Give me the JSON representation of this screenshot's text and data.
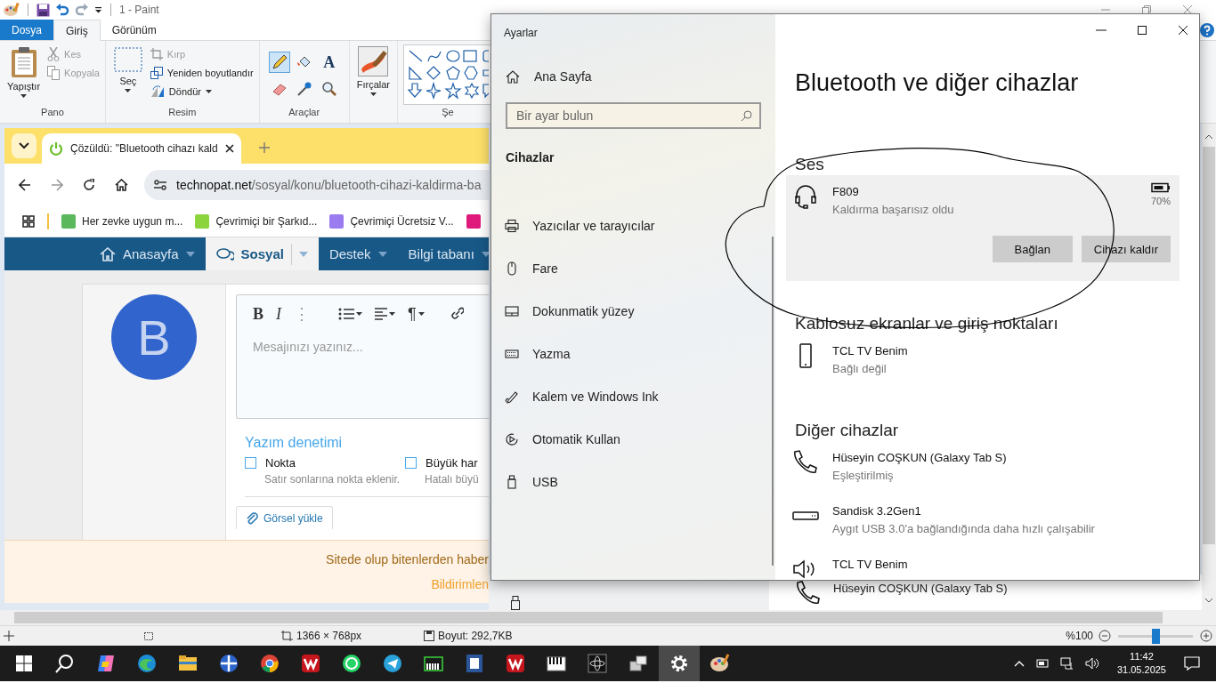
{
  "paint": {
    "title": "1 - Paint",
    "tabs": [
      {
        "label": "Dosya",
        "kind": "file",
        "selected": false
      },
      {
        "label": "Giriş",
        "kind": "tab",
        "selected": true
      },
      {
        "label": "Görünüm",
        "kind": "tab",
        "selected": false
      }
    ],
    "groups": [
      {
        "kind": "big",
        "label": "Pano",
        "big": {
          "kind": "clipboard",
          "label": "Yapıştır"
        },
        "items": [
          {
            "kind": "scissors",
            "label": "Kes",
            "disabled": true
          },
          {
            "kind": "copy",
            "label": "Kopyala",
            "disabled": true
          }
        ]
      },
      {
        "kind": "big",
        "label": "Resim",
        "big": {
          "kind": "select",
          "label": "Seç"
        },
        "items": [
          {
            "kind": "crop",
            "label": "Kırp",
            "disabled": true
          },
          {
            "kind": "resize",
            "label": "Yeniden boyutlandır",
            "disabled": false
          },
          {
            "kind": "rotate",
            "label": "Döndür",
            "disabled": false,
            "dropdown": true
          }
        ]
      },
      {
        "kind": "tools",
        "label": "Araçlar",
        "tools": [
          {
            "kind": "pencil",
            "selected": true
          },
          {
            "kind": "fill",
            "selected": false
          },
          {
            "kind": "text",
            "label": "A",
            "selected": false
          },
          {
            "kind": "eraser",
            "selected": false
          },
          {
            "kind": "picker",
            "selected": false
          },
          {
            "kind": "magnifier",
            "selected": false
          }
        ]
      },
      {
        "kind": "big",
        "big": {
          "kind": "brush",
          "label": "Fırçalar"
        }
      },
      {
        "kind": "shapes",
        "label": "Şe"
      }
    ],
    "status": {
      "size": "1366 × 768px",
      "file_size": "Boyut: 292,7KB",
      "zoom": "%100",
      "zoom_slider": {
        "level": 0.5
      }
    }
  },
  "browser": {
    "tab_title": "Çözüldü: \"Bluetooth cihazı kald",
    "domain": "technopat.net",
    "path": "/sosyal/konu/bluetooth-cihazi-kaldirma-ba",
    "bookmarks": [
      {
        "label": "Her zevke uygun m...",
        "color": "#5cb85c"
      },
      {
        "label": "Çevrimiçi bir Şarkıd...",
        "color": "#8cd43c"
      },
      {
        "label": "Çevrimiçi Ücretsiz V...",
        "color": "#9a7cf0"
      },
      {
        "color": "#e0197d"
      }
    ],
    "nav": [
      {
        "label": "Anasayfa",
        "kind": "home",
        "selected": false
      },
      {
        "label": "Sosyal",
        "kind": "chat",
        "selected": true
      },
      {
        "label": "Destek",
        "kind": "plain",
        "selected": false
      },
      {
        "label": "Bilgi tabanı",
        "kind": "plain",
        "selected": false
      }
    ],
    "avatar": "B",
    "toolbar": [
      {
        "kind": "bold",
        "label": "B"
      },
      {
        "kind": "italic",
        "label": "I"
      },
      {
        "kind": "more",
        "label": "⋮"
      },
      {
        "kind": "list"
      },
      {
        "kind": "align"
      },
      {
        "kind": "paragraph",
        "label": "¶"
      },
      {
        "kind": "link"
      }
    ],
    "placeholder": "Mesajınızı yazınız...",
    "spellcheck_title": "Yazım denetimi",
    "options": [
      {
        "label": "Nokta",
        "hint": "Satır sonlarına nokta eklenir.",
        "checked": false
      },
      {
        "label": "Büyük har",
        "hint": "Hatalı büyü",
        "checked": false
      }
    ],
    "upload": "Görsel yükle",
    "notice": {
      "text": "Sitede olup bitenlerden haber",
      "link": "Bildirimlen"
    }
  },
  "background_device": "Hüseyin COŞKUN (Galaxy Tab S)",
  "settings": {
    "title": "Ayarlar",
    "home": "Ana Sayfa",
    "search_placeholder": "Bir ayar bulun",
    "section": "Cihazlar",
    "nav": [
      {
        "kind": "printer",
        "label": "Yazıcılar ve tarayıcılar"
      },
      {
        "kind": "mouse",
        "label": "Fare"
      },
      {
        "kind": "touchpad",
        "label": "Dokunmatik yüzey"
      },
      {
        "kind": "keyboard",
        "label": "Yazma"
      },
      {
        "kind": "pen",
        "label": "Kalem ve Windows Ink"
      },
      {
        "kind": "autoplay",
        "label": "Otomatik Kullan"
      },
      {
        "kind": "usb",
        "label": "USB"
      }
    ],
    "heading": "Bluetooth ve diğer cihazlar",
    "groups": [
      {
        "title": "Ses",
        "devices": [
          {
            "kind": "headset",
            "name": "F809",
            "status": "Kaldırma başarısız oldu",
            "battery": "70%",
            "selected": true,
            "buttons": [
              "Bağlan",
              "Cihazı kaldır"
            ]
          }
        ]
      },
      {
        "title": "Kablosuz ekranlar ve giriş noktaları",
        "devices": [
          {
            "kind": "mobile",
            "name": "TCL TV Benim",
            "status": "Bağlı değil",
            "selected": false
          }
        ]
      },
      {
        "title": "Diğer cihazlar",
        "devices": [
          {
            "kind": "phone",
            "name": "Hüseyin COŞKUN (Galaxy Tab S)",
            "status": "Eşleştirilmiş",
            "selected": false
          },
          {
            "kind": "drive",
            "name": "Sandisk 3.2Gen1",
            "status": "Aygıt USB 3.0'a bağlandığında daha hızlı çalışabilir",
            "selected": false
          },
          {
            "kind": "speaker",
            "name": "TCL TV Benim",
            "selected": false
          }
        ]
      }
    ]
  },
  "taskbar": {
    "apps": [
      {
        "kind": "start",
        "selected": false
      },
      {
        "kind": "search",
        "selected": false
      },
      {
        "kind": "copilot",
        "selected": false
      },
      {
        "kind": "edge",
        "selected": false
      },
      {
        "kind": "explorer",
        "selected": false
      },
      {
        "kind": "globe",
        "selected": false
      },
      {
        "kind": "chrome",
        "selected": false
      },
      {
        "kind": "zigzag",
        "selected": false
      },
      {
        "kind": "whatsapp",
        "selected": false
      },
      {
        "kind": "telegram",
        "selected": false
      },
      {
        "kind": "synth",
        "selected": false
      },
      {
        "kind": "word",
        "selected": false
      },
      {
        "kind": "zigzag",
        "selected": false
      },
      {
        "kind": "piano",
        "selected": false
      },
      {
        "kind": "atom",
        "selected": false
      },
      {
        "kind": "drive",
        "selected": false
      },
      {
        "kind": "settings",
        "selected": true
      },
      {
        "kind": "paint",
        "selected": false
      }
    ],
    "time": "11:42",
    "date": "31.05.2025"
  }
}
